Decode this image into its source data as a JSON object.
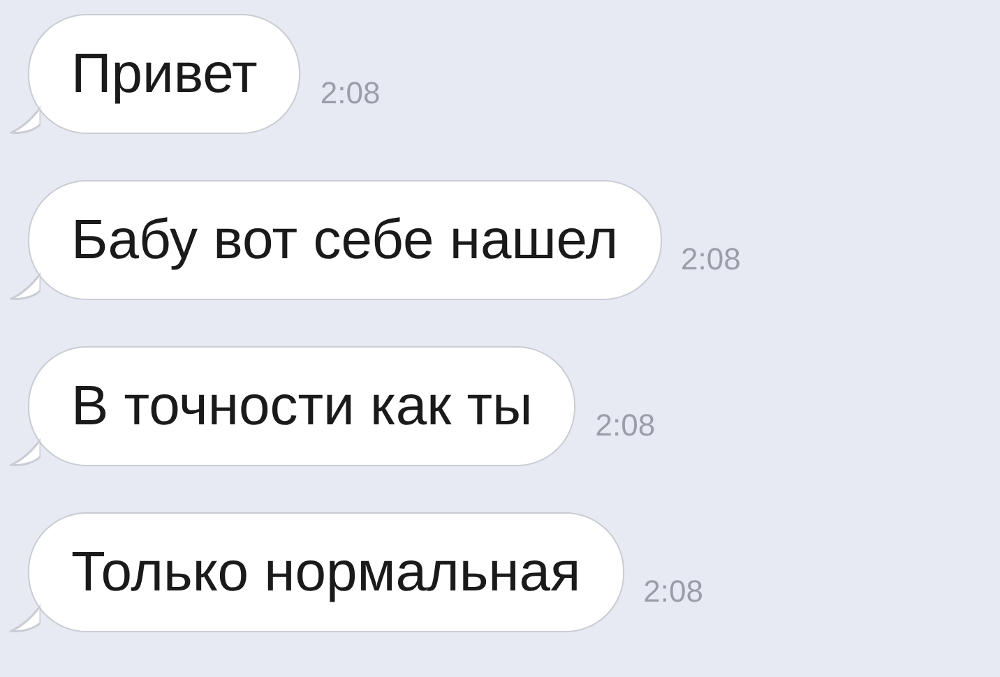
{
  "messages": [
    {
      "text": "Привет",
      "time": "2:08"
    },
    {
      "text": "Бабу вот себе нашел",
      "time": "2:08"
    },
    {
      "text": "В точности как ты",
      "time": "2:08"
    },
    {
      "text": "Только нормальная",
      "time": "2:08"
    }
  ]
}
